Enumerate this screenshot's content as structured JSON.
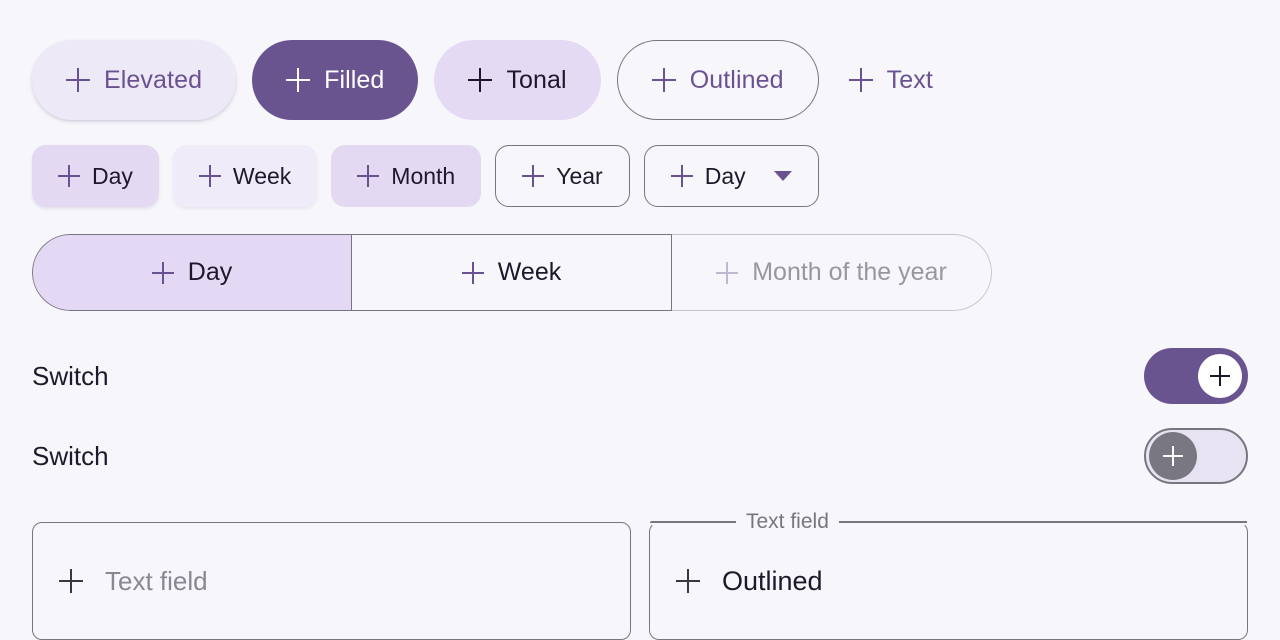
{
  "theme": {
    "background": "#F7F6FB",
    "primary": "#69548F",
    "on_primary": "#FFFFFF",
    "primary_text": "#6A5292",
    "tonal_container": "#E4DAF4",
    "elevated_container": "#EDE9F6",
    "outline": "#79757F",
    "on_surface": "#1D192B",
    "disabled_text": "#9A96A0",
    "placeholder": "#8B8792"
  },
  "common_buttons": [
    {
      "label": "Elevated",
      "icon": "plus-icon",
      "variant": "elevated"
    },
    {
      "label": "Filled",
      "icon": "plus-icon",
      "variant": "filled"
    },
    {
      "label": "Tonal",
      "icon": "plus-icon",
      "variant": "tonal"
    },
    {
      "label": "Outlined",
      "icon": "plus-icon",
      "variant": "outlined"
    },
    {
      "label": "Text",
      "icon": "plus-icon",
      "variant": "text"
    }
  ],
  "chip_buttons": [
    {
      "label": "Day",
      "icon": "plus-icon",
      "variant": "tonal-strong",
      "has_dropdown": false
    },
    {
      "label": "Week",
      "icon": "plus-icon",
      "variant": "tonal-light",
      "has_dropdown": false
    },
    {
      "label": "Month",
      "icon": "plus-icon",
      "variant": "tonal-plain",
      "has_dropdown": false
    },
    {
      "label": "Year",
      "icon": "plus-icon",
      "variant": "outlined",
      "has_dropdown": false
    },
    {
      "label": "Day",
      "icon": "plus-icon",
      "variant": "outlined",
      "has_dropdown": true,
      "dropdown_icon": "caret-down-icon"
    }
  ],
  "segmented_button": {
    "segments": [
      {
        "label": "Day",
        "icon": "plus-icon",
        "selected": true,
        "disabled": false
      },
      {
        "label": "Week",
        "icon": "plus-icon",
        "selected": false,
        "disabled": false
      },
      {
        "label": "Month of the year",
        "icon": "plus-icon",
        "selected": false,
        "disabled": true
      }
    ]
  },
  "switches": [
    {
      "label": "Switch",
      "state": "on",
      "thumb_icon": "plus-icon"
    },
    {
      "label": "Switch",
      "state": "off",
      "thumb_icon": "plus-icon"
    }
  ],
  "text_fields": [
    {
      "variant": "filled",
      "icon": "plus-icon",
      "label": "",
      "value": "",
      "placeholder": "Text field"
    },
    {
      "variant": "outlined",
      "icon": "plus-icon",
      "label": "Text field",
      "value": "Outlined",
      "placeholder": ""
    }
  ]
}
